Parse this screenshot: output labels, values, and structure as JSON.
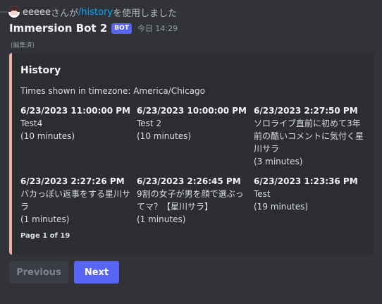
{
  "reply": {
    "user": "eeeee",
    "middle": "さんが",
    "command": "/history",
    "suffix": "を使用しました"
  },
  "message": {
    "author": "Immersion Bot 2",
    "tag": "BOT",
    "timestamp": "今日 14:29",
    "edited": "(編集済)"
  },
  "embed": {
    "accent_color": "#f0b0a7",
    "title": "History",
    "description": "Times shown in timezone: America/Chicago",
    "fields": [
      {
        "name": "6/23/2023 11:00:00 PM",
        "title": "Test4",
        "duration": "(10 minutes)"
      },
      {
        "name": "6/23/2023 10:00:00 PM",
        "title": "Test 2",
        "duration": "(10 minutes)"
      },
      {
        "name": "6/23/2023 2:27:50 PM",
        "title": "ソロライブ直前に初めて3年前の酷いコメントに気付く星川サラ",
        "duration": "(3 minutes)"
      },
      {
        "name": "6/23/2023 2:27:26 PM",
        "title": "バカっぽい返事をする星川サラ",
        "duration": "(1 minutes)"
      },
      {
        "name": "6/23/2023 2:26:45 PM",
        "title": "9割の女子が男を顔で選ぶってマ？【星川サラ】",
        "duration": "(1 minutes)"
      },
      {
        "name": "6/23/2023 1:23:36 PM",
        "title": "Test",
        "duration": "(19 minutes)"
      }
    ],
    "footer": "Page 1 of 19"
  },
  "buttons": {
    "previous": "Previous",
    "next": "Next"
  }
}
